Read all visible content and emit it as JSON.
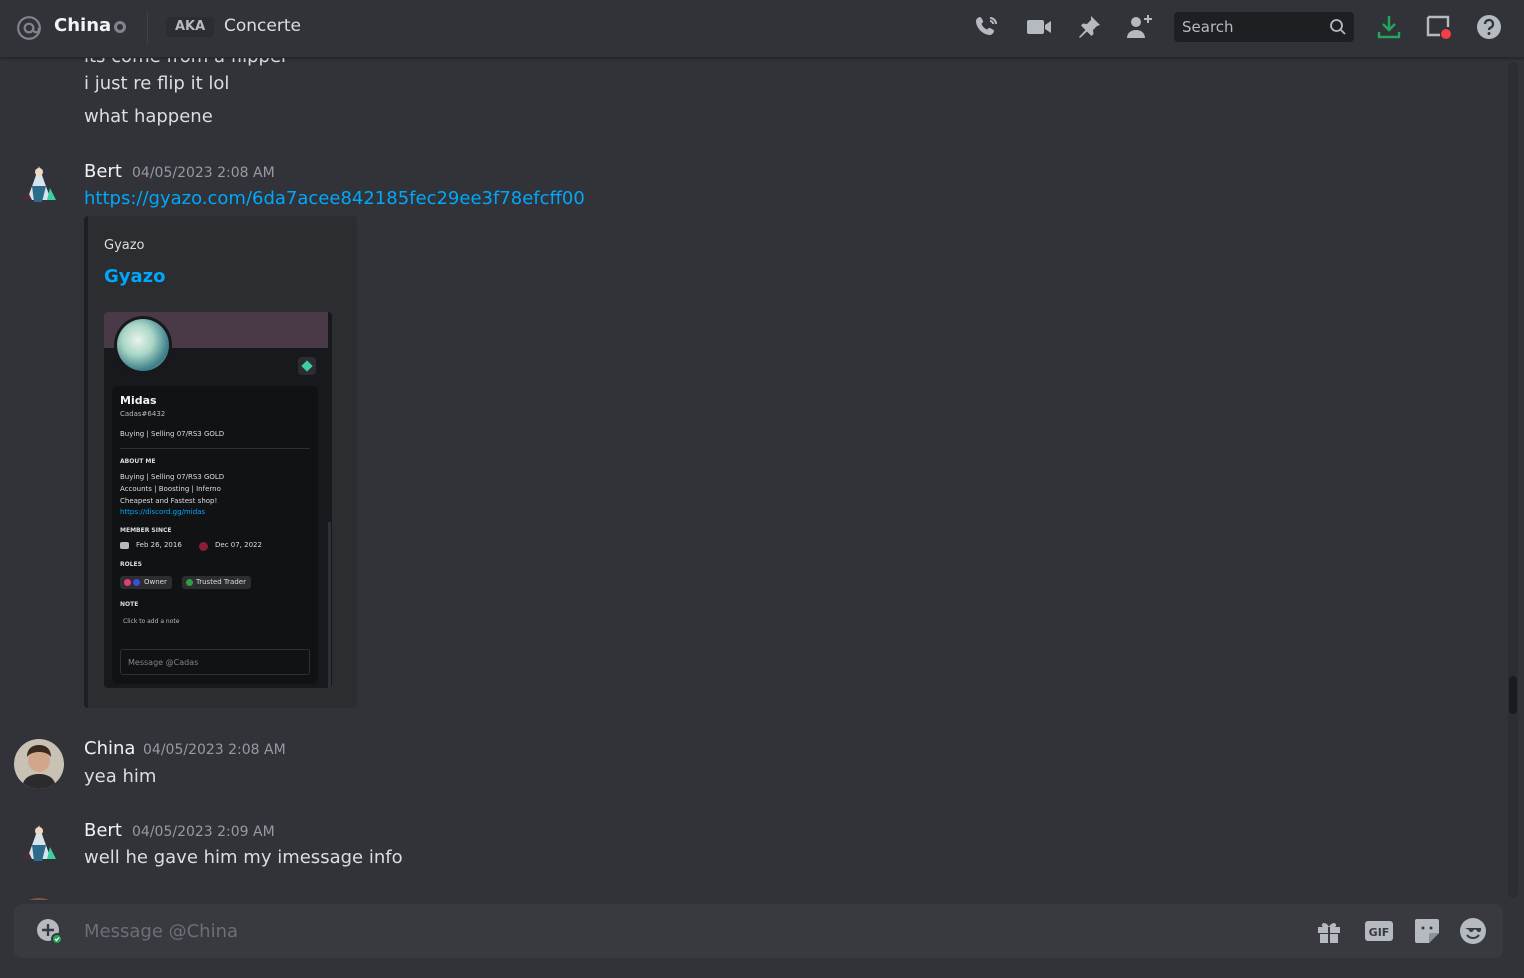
{
  "header": {
    "channel_name": "China",
    "aka_label": "AKA",
    "nickname": "Concerte",
    "search_placeholder": "Search",
    "icons": [
      "at-icon",
      "voice-call-icon",
      "video-call-icon",
      "pin-icon",
      "add-friend-icon",
      "search-icon",
      "download-icon",
      "inbox-icon",
      "help-icon"
    ],
    "status_color": "#80848e",
    "download_color": "#23a55a",
    "notification_dot_color": "#f23f43"
  },
  "messages": {
    "partial_top": "its come from a flipper",
    "line1": "i just re flip it lol",
    "line2": "what happene",
    "msg2": {
      "author": "Bert",
      "timestamp": "04/05/2023 2:08 AM",
      "link": "https://gyazo.com/6da7acee842185fec29ee3f78efcff00",
      "embed": {
        "provider": "Gyazo",
        "title": "Gyazo",
        "card": {
          "name": "Midas",
          "tag": "Cadas#6432",
          "subtitle": "Buying | Selling 07/RS3 GOLD",
          "about_heading": "ABOUT ME",
          "about_lines": [
            "Buying | Selling 07/RS3 GOLD",
            "Accounts | Boosting | Inferno",
            "Cheapest and Fastest shop!"
          ],
          "about_link": "https://discord.gg/midas",
          "member_heading": "MEMBER SINCE",
          "member_discord": "Feb 26, 2016",
          "member_server": "Dec 07, 2022",
          "roles_heading": "ROLES",
          "roles": [
            "Owner",
            "Trusted Trader"
          ],
          "note_heading": "NOTE",
          "note_placeholder": "Click to add a note",
          "message_placeholder": "Message @Cadas"
        }
      }
    },
    "msg3": {
      "author": "China",
      "timestamp": "04/05/2023 2:08 AM",
      "text": "yea him"
    },
    "msg4": {
      "author": "Bert",
      "timestamp": "04/05/2023 2:09 AM",
      "text": "well he gave him my imessage info"
    }
  },
  "composer": {
    "placeholder": "Message @China",
    "gif_label": "GIF",
    "icons": [
      "add-attachment-icon",
      "gift-icon",
      "gif-icon",
      "sticker-icon",
      "emoji-icon"
    ]
  },
  "colors": {
    "background": "#313338",
    "link": "#00a8fc",
    "text": "#dbdee1",
    "muted": "#949ba4"
  }
}
